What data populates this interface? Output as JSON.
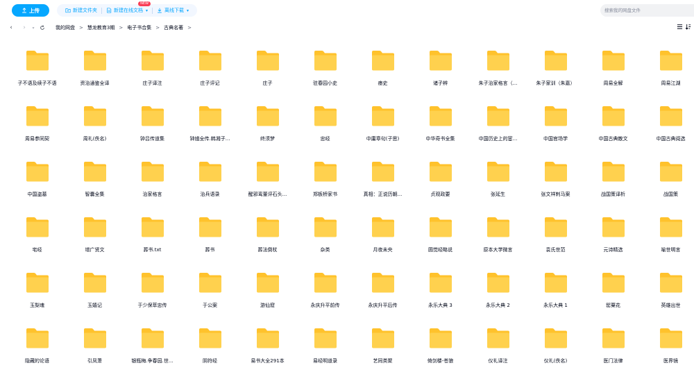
{
  "toolbar": {
    "upload_label": "上传",
    "new_folder_label": "新建文件夹",
    "new_online_doc_label": "新建在线文档",
    "new_badge": "NEW",
    "offline_download_label": "离线下载",
    "search_placeholder": "搜索我的网盘文件"
  },
  "breadcrumb": [
    "我的网盘",
    "慧龙教育3期",
    "电子书合集",
    "古典名著"
  ],
  "colors": {
    "accent": "#06a7ff",
    "folder": "#ffd14e",
    "folder_back": "#ffc22c"
  },
  "rows": [
    [
      "子不语及续子不语",
      "资治通鉴全译",
      "庄子译注",
      "庄子评记",
      "庄子",
      "驻春园小史",
      "瘗史",
      "诸子辨",
      "朱子治家格言（...",
      "朱子家训（朱嘉）",
      "周易全解",
      "周易江湖"
    ],
    [
      "周易参同契",
      "周礼(佚名)",
      "钟吕传道集",
      "钟馗全传.韩湘子...",
      "终须梦",
      "忠经",
      "中庸章句(子思)",
      "中华奇书全集",
      "中国历史上的宦...",
      "中国官场学",
      "中国古典散文",
      "中国古典阅选"
    ],
    [
      "中国盗墓",
      "智囊全集",
      "治家格言",
      "治兵语录",
      "醒邪鸾董评石头...",
      "郑板桥家书",
      "真相：正说历朝...",
      "贞观政要",
      "张延生",
      "张文祥刺马案",
      "战国策译析",
      "战国策"
    ],
    [
      "宅经",
      "增广贤文",
      "葬书.txt",
      "葬书",
      "葬法倒杖",
      "杂类",
      "月夜未央",
      "圆觉经略说",
      "原本大学微言",
      "袁氏世范",
      "元诗精选",
      "喻世明言"
    ],
    [
      "玉梨魂",
      "玉嬉记",
      "于少保萃忠传",
      "于公案",
      "游仙窟",
      "永庆升平前传",
      "永庆升平后传",
      "永乐大典 3",
      "永乐大典 2",
      "永乐大典 1",
      "罂粟花",
      "英雄出世"
    ],
    [
      "隐藏的论语",
      "引凤萧",
      "银瓶梅.争春园.世...",
      "阴符经",
      "易书大全291本",
      "易经明道录",
      "艺同类聚",
      "倚剑楼-苍狼",
      "仪礼译注",
      "仪礼(佚名)",
      "医门法律",
      "医界镜"
    ]
  ]
}
